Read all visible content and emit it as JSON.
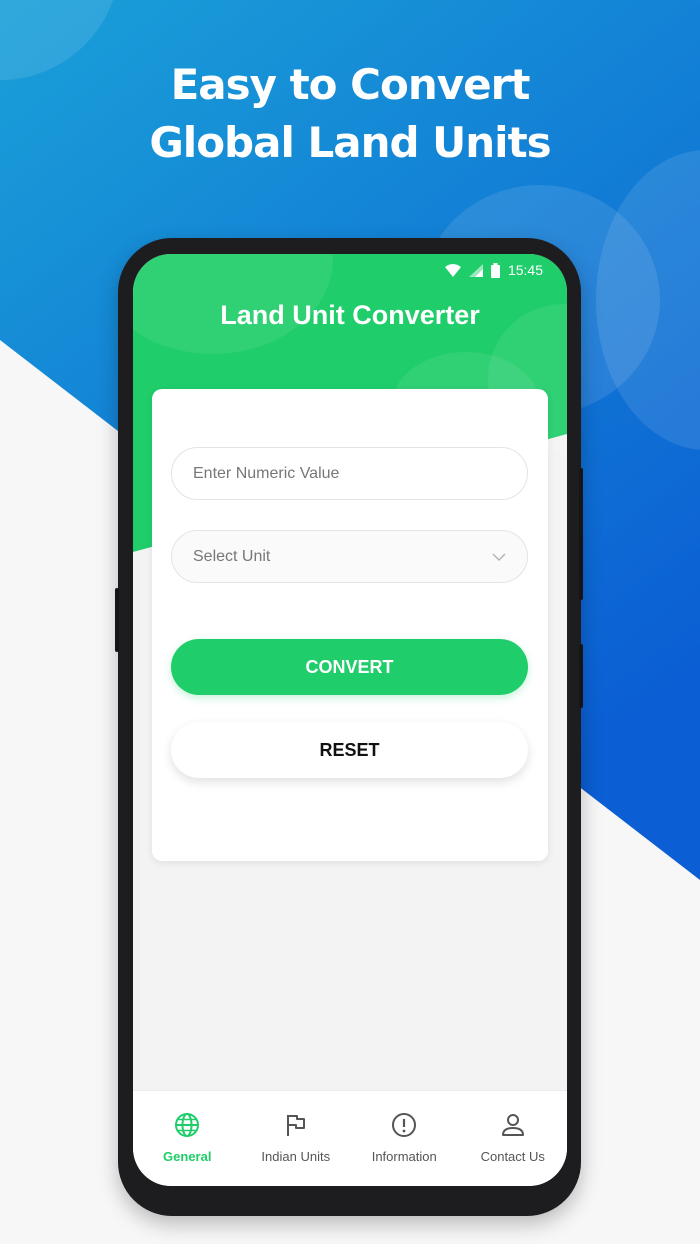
{
  "colors": {
    "blue_top": "#1a9ed6",
    "blue_bottom": "#0d63d4",
    "green": "#1fcd6a",
    "page_bg": "#f7f7f8"
  },
  "headline": {
    "line1": "Easy to Convert",
    "line2": "Global Land Units"
  },
  "status_bar": {
    "icons": [
      "wifi-icon",
      "signal-icon",
      "battery-icon"
    ],
    "time": "15:45"
  },
  "app": {
    "title": "Land Unit Converter"
  },
  "form": {
    "value_placeholder": "Enter Numeric Value",
    "value": "",
    "unit_select": "Select Unit",
    "convert_label": "CONVERT",
    "reset_label": "RESET"
  },
  "bottom_nav": {
    "items": [
      {
        "label": "General",
        "icon": "globe-icon",
        "active": true
      },
      {
        "label": "Indian Units",
        "icon": "flag-icon",
        "active": false
      },
      {
        "label": "Information",
        "icon": "info-icon",
        "active": false
      },
      {
        "label": "Contact Us",
        "icon": "user-icon",
        "active": false
      }
    ]
  }
}
